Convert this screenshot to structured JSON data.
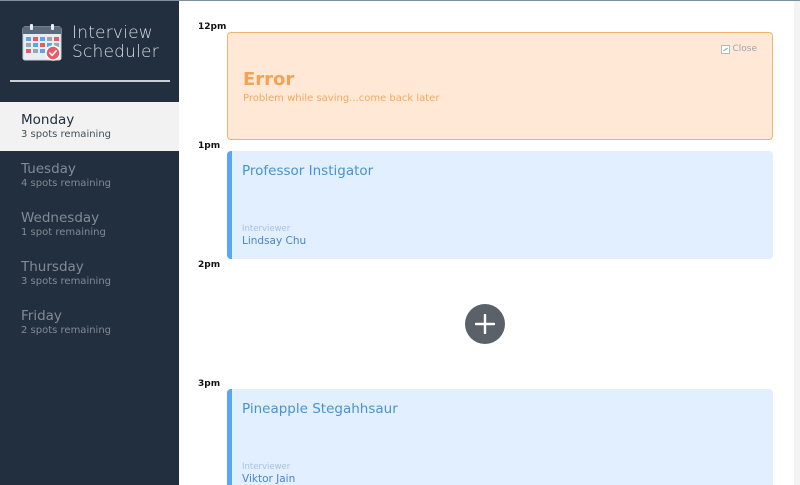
{
  "app": {
    "brand_line1": "Interview",
    "brand_line2": "Scheduler"
  },
  "sidebar": {
    "days": [
      {
        "name": "Monday",
        "spots": "3 spots remaining",
        "selected": true
      },
      {
        "name": "Tuesday",
        "spots": "4 spots remaining",
        "selected": false
      },
      {
        "name": "Wednesday",
        "spots": "1 spot remaining",
        "selected": false
      },
      {
        "name": "Thursday",
        "spots": "3 spots remaining",
        "selected": false
      },
      {
        "name": "Friday",
        "spots": "2 spots remaining",
        "selected": false
      }
    ]
  },
  "schedule": {
    "times": [
      "12pm",
      "1pm",
      "2pm",
      "3pm"
    ],
    "error": {
      "title": "Error",
      "message": "Problem while saving...come back later",
      "close_alt": "Close"
    },
    "appointments": [
      {
        "student": "Professor Instigator",
        "interviewer_label": "Interviewer",
        "interviewer": "Lindsay Chu"
      },
      {
        "student": "Pineapple Stegahhsaur",
        "interviewer_label": "Interviewer",
        "interviewer": "Viktor Jain"
      }
    ],
    "add_icon": "plus-icon"
  },
  "colors": {
    "sidebar_bg": "#222f3e",
    "selected_day_bg": "#f2f2f2",
    "error_bg": "#ffe9d6",
    "error_accent": "#f2a259",
    "appointment_bg": "#e1efff",
    "appointment_accent": "#58a6f4",
    "add_button": "#5b6168"
  }
}
